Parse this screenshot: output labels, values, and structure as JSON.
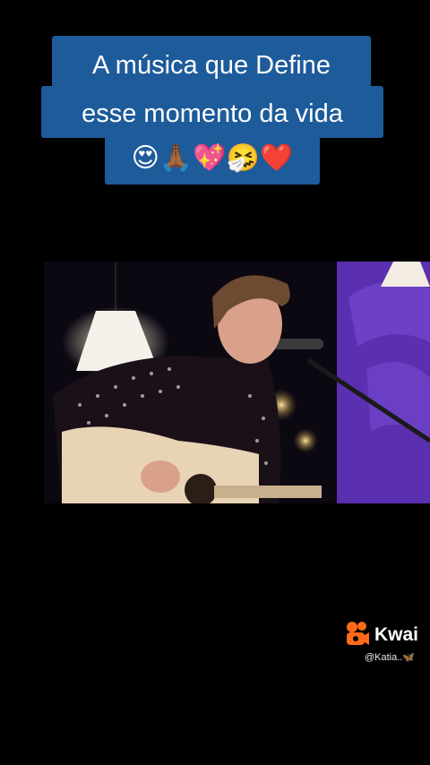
{
  "caption": {
    "line1": "A música que Define",
    "line2": "esse momento da vida",
    "emojis": "😍🙏🏾💖🤧❤️"
  },
  "watermark": {
    "brand": "Kwai",
    "username": "@Katia..🦋",
    "brand_color": "#ff6a1a"
  },
  "colors": {
    "caption_bg": "#1d5b9a",
    "page_bg": "#000000"
  }
}
